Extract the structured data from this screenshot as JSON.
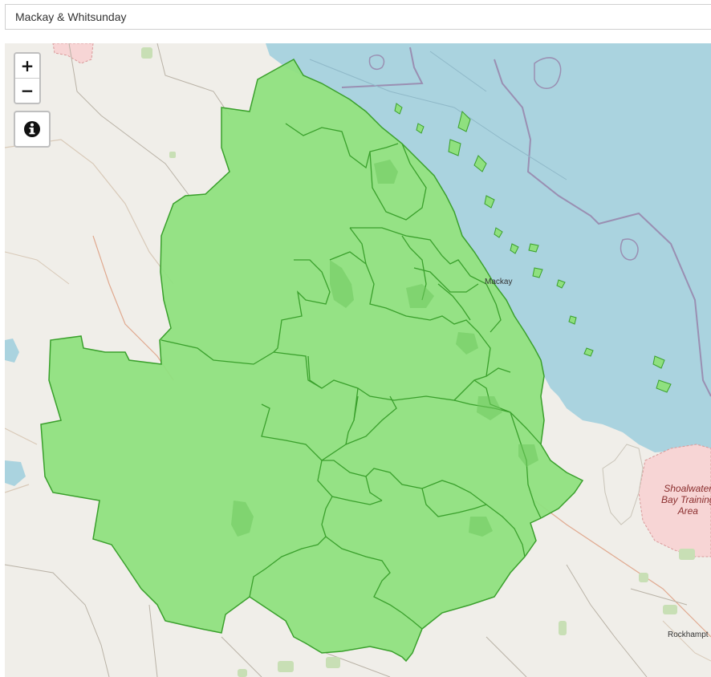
{
  "search": {
    "value": "Mackay & Whitsunday"
  },
  "map": {
    "controls": {
      "zoom_in_label": "+",
      "zoom_out_label": "−",
      "info_icon": "info-circle-icon"
    },
    "labels": {
      "town_mackay": "Mackay",
      "town_rockhampton": "Rockhampt",
      "military_area_line1": "Shoalwater",
      "military_area_line2": "Bay Training",
      "military_area_line3": "Area"
    },
    "highlighted_region": "Mackay & Whitsunday",
    "colors": {
      "region_fill": "#8fe07f",
      "region_border": "#3aa02c",
      "sea": "#aad3df",
      "land": "#f0eee9",
      "military": "#f7d5d5"
    }
  }
}
